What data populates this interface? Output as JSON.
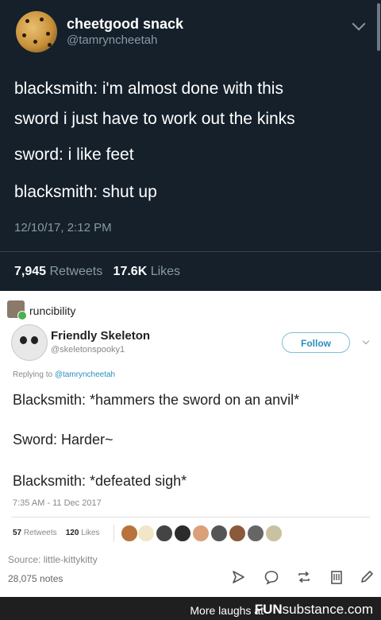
{
  "dark_tweet": {
    "display_name": "cheetgood snack",
    "handle": "@tamryncheetah",
    "lines": [
      "blacksmith: i'm almost done with this",
      "sword i just have to work out the kinks",
      "sword: i like feet",
      "blacksmith: shut up"
    ],
    "timestamp": "12/10/17, 2:12 PM",
    "retweets_count": "7,945",
    "retweets_label": "Retweets",
    "likes_count": "17.6K",
    "likes_label": "Likes"
  },
  "reblog": {
    "reblogger": "runcibility",
    "author_name": "Friendly Skeleton",
    "author_handle": "@skeletonspooky1",
    "follow_label": "Follow",
    "replying_prefix": "Replying to",
    "replying_to": "@tamryncheetah",
    "lines": [
      "Blacksmith: *hammers the sword on an anvil*",
      "Sword: Harder~",
      "Blacksmith: *defeated sigh*"
    ],
    "timestamp": "7:35 AM - 11 Dec 2017",
    "retweets_count": "57",
    "retweets_label": "Retweets",
    "likes_count": "120",
    "likes_label": "Likes",
    "source": "Source: little-kittykitty",
    "notes": "28,075 notes"
  },
  "footer": {
    "more": "More laughs at",
    "brand_fun": "FUN",
    "brand_sub": "substance",
    "brand_com": ".com"
  },
  "icons": [
    "chevron-down-icon",
    "send-icon",
    "reply-icon",
    "reblog-icon",
    "queue-icon",
    "edit-icon"
  ]
}
